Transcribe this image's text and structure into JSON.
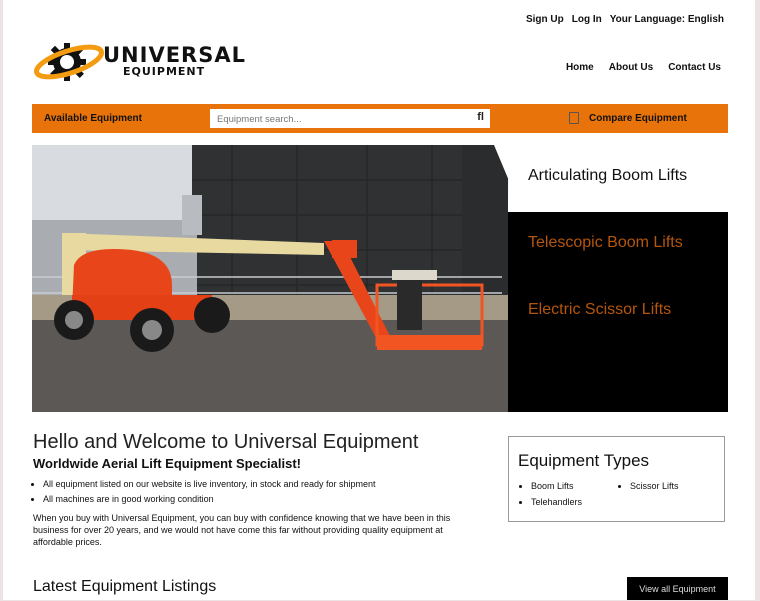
{
  "utility_links": [
    "Sign Up",
    "Log In",
    "Your Language: English"
  ],
  "logo": {
    "line1": "UNIVERSAL",
    "line2": "EQUIPMENT",
    "accent": "#f39c12"
  },
  "main_nav": [
    "Home",
    "About Us",
    "Contact Us"
  ],
  "toolbar": {
    "available_label": "Available Equipment",
    "search_placeholder": "Equipment search...",
    "search_icon": "search-icon",
    "compare_label": "Compare Equipment",
    "bar_color": "#e8730a"
  },
  "hero": {
    "photo_alt": "Orange articulating boom lift in front of storage tanks",
    "tabs": [
      {
        "label": "Articulating Boom Lifts",
        "active": true
      },
      {
        "label": "Telescopic Boom Lifts",
        "active": false
      },
      {
        "label": "Electric Scissor Lifts",
        "active": false
      }
    ]
  },
  "welcome": {
    "title": "Hello and Welcome to Universal Equipment",
    "subtitle": "Worldwide Aerial Lift Equipment Specialist!",
    "bullets": [
      "All equipment listed on our website is live inventory, in stock and ready for shipment",
      "All machines are in good working condition"
    ],
    "paragraph": "When you buy with Universal Equipment, you can buy with confidence knowing that we have been in this business for over 20 years, and we would not have come this far without providing quality equipment at affordable prices."
  },
  "equipment_types": {
    "title": "Equipment Types",
    "col1": [
      "Boom Lifts",
      "Telehandlers"
    ],
    "col2": [
      "Scissor Lifts"
    ]
  },
  "latest": {
    "title": "Latest Equipment Listings",
    "view_all_label": "View all Equipment"
  }
}
